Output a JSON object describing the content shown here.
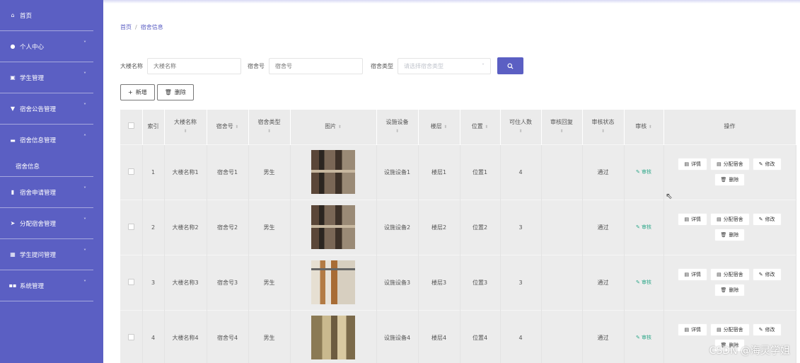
{
  "sidebar": {
    "items": [
      {
        "label": "首页",
        "icon": "home-icon",
        "glyph": "⌂",
        "expandable": false
      },
      {
        "label": "个人中心",
        "icon": "user-icon",
        "glyph": "●",
        "expandable": true
      },
      {
        "label": "学生管理",
        "icon": "student-icon",
        "glyph": "▣",
        "expandable": true
      },
      {
        "label": "宿舍公告管理",
        "icon": "notice-icon",
        "glyph": "▼",
        "expandable": true
      },
      {
        "label": "宿舍信息管理",
        "icon": "dorm-info-icon",
        "glyph": "▬",
        "expandable": true
      }
    ],
    "sub_item": "宿舍信息",
    "items2": [
      {
        "label": "宿舍申请管理",
        "icon": "bar-chart-icon",
        "glyph": "▮",
        "expandable": true
      },
      {
        "label": "分配宿舍管理",
        "icon": "send-icon",
        "glyph": "➤",
        "expandable": true
      },
      {
        "label": "学生提问管理",
        "icon": "question-icon",
        "glyph": "▦",
        "expandable": true
      },
      {
        "label": "系统管理",
        "icon": "grid-icon",
        "glyph": "▪▪",
        "expandable": true
      }
    ]
  },
  "breadcrumb": {
    "home": "首页",
    "separator": "/",
    "current": "宿舍信息"
  },
  "filters": {
    "building_label": "大楼名称",
    "building_placeholder": "大楼名称",
    "room_label": "宿舍号",
    "room_placeholder": "宿舍号",
    "type_label": "宿舍类型",
    "type_placeholder": "请选择宿舍类型"
  },
  "actions": {
    "add": "新增",
    "delete": "删除"
  },
  "table": {
    "headers": {
      "index": "索引",
      "building": "大楼名称",
      "room": "宿舍号",
      "type": "宿舍类型",
      "image": "图片",
      "facility": "设施设备",
      "floor": "楼层",
      "position": "位置",
      "capacity": "可住人数",
      "reply": "审核回复",
      "status": "审核状态",
      "audit": "审核",
      "ops": "操作"
    },
    "rows": [
      {
        "index": "1",
        "building": "大楼名称1",
        "room": "宿舍号1",
        "type": "男生",
        "facility": "设施设备1",
        "floor": "楼层1",
        "position": "位置1",
        "capacity": "4",
        "reply": "",
        "status": "通过",
        "audit": "审核"
      },
      {
        "index": "2",
        "building": "大楼名称2",
        "room": "宿舍号2",
        "type": "男生",
        "facility": "设施设备2",
        "floor": "楼层2",
        "position": "位置2",
        "capacity": "3",
        "reply": "",
        "status": "通过",
        "audit": "审核"
      },
      {
        "index": "3",
        "building": "大楼名称3",
        "room": "宿舍号3",
        "type": "男生",
        "facility": "设施设备3",
        "floor": "楼层3",
        "position": "位置3",
        "capacity": "3",
        "reply": "",
        "status": "通过",
        "audit": "审核"
      },
      {
        "index": "4",
        "building": "大楼名称4",
        "room": "宿舍号4",
        "type": "男生",
        "facility": "设施设备4",
        "floor": "楼层4",
        "position": "位置4",
        "capacity": "4",
        "reply": "",
        "status": "通过",
        "audit": "审核"
      }
    ],
    "op_labels": {
      "detail": "详情",
      "assign": "分配宿舍",
      "edit": "修改",
      "delete": "删除"
    }
  },
  "watermark": "CSDN @海灵学姐",
  "colors": {
    "sidebar": "#5b5fc3",
    "accent": "#5b5fc3",
    "audit_link": "#2fa88a"
  }
}
